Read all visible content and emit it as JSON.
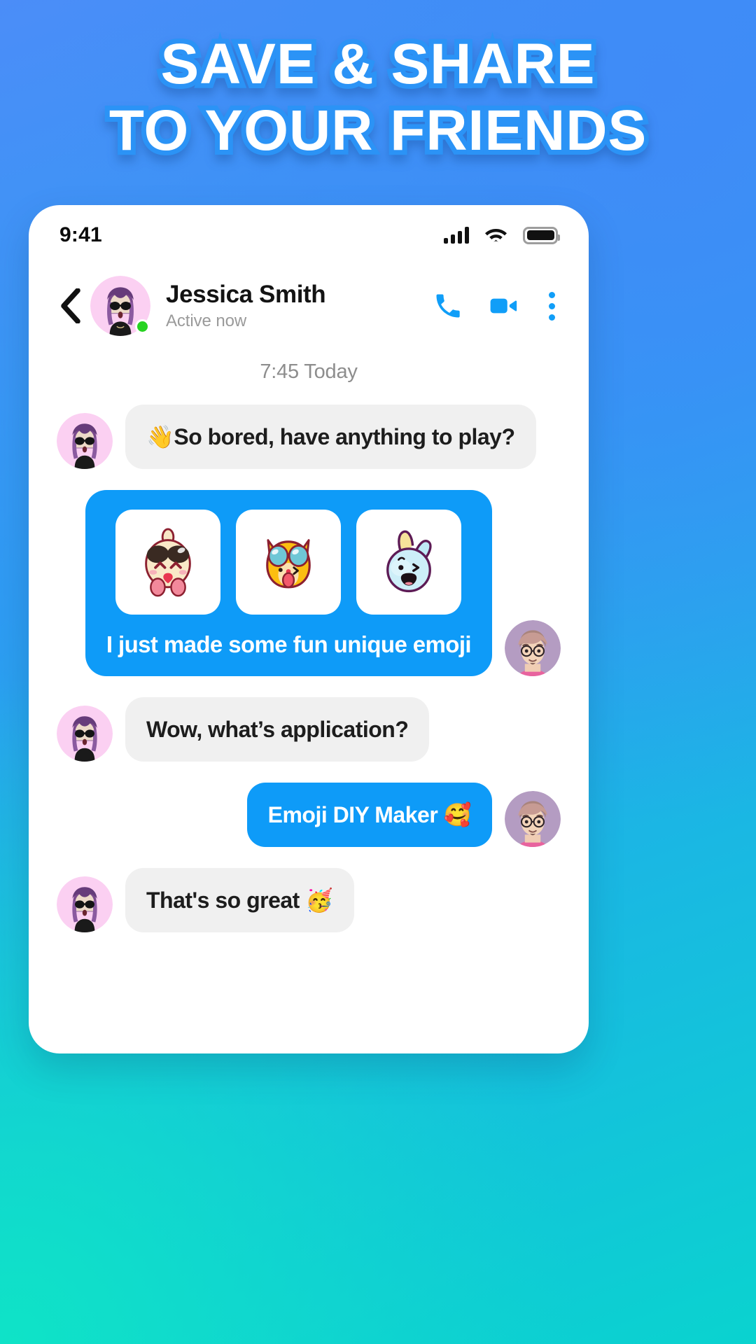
{
  "headline": {
    "line1": "SAVE & SHARE",
    "line2": "TO YOUR FRIENDS"
  },
  "colors": {
    "accent_blue": "#0E9BF8",
    "headline_stroke": "#2B93F6",
    "incoming_bubble": "#F0F0F0",
    "online_dot": "#27D321",
    "bg_from": "#4B8DF8",
    "bg_to": "#0AD3CF"
  },
  "status_bar": {
    "time": "9:41",
    "icons": [
      "signal-bars-icon",
      "wifi-icon",
      "battery-icon"
    ]
  },
  "chat_header": {
    "back_icon": "chevron-left-icon",
    "name": "Jessica Smith",
    "status": "Active now",
    "presence": "online",
    "actions": [
      {
        "name": "voice-call-button",
        "icon": "phone-icon"
      },
      {
        "name": "video-call-button",
        "icon": "video-camera-icon"
      },
      {
        "name": "more-options-button",
        "icon": "kebab-menu-icon"
      }
    ]
  },
  "conversation": {
    "daystamp": "7:45 Today",
    "messages": [
      {
        "id": "msg-1",
        "side": "in",
        "type": "text",
        "avatar": "jessica-avatar",
        "text": "👋So bored, have anything to play?"
      },
      {
        "id": "msg-2",
        "side": "out",
        "type": "stickers",
        "avatar": "me-avatar",
        "caption": "I just made some fun unique emoji",
        "stickers": [
          {
            "name": "sticker-bunny-sunglasses",
            "label": "cream bunny with black sunglasses"
          },
          {
            "name": "sticker-cat-sunglasses",
            "label": "orange cat with blue sunglasses"
          },
          {
            "name": "sticker-blue-bunny",
            "label": "light blue bunny winking"
          }
        ]
      },
      {
        "id": "msg-3",
        "side": "in",
        "type": "text",
        "avatar": "jessica-avatar",
        "text": "Wow, what’s application?"
      },
      {
        "id": "msg-4",
        "side": "out",
        "type": "text",
        "avatar": "me-avatar",
        "text": "Emoji  DIY Maker 🥰"
      },
      {
        "id": "msg-5",
        "side": "in",
        "type": "text",
        "avatar": "jessica-avatar",
        "text": "That's so great 🥳"
      }
    ]
  }
}
